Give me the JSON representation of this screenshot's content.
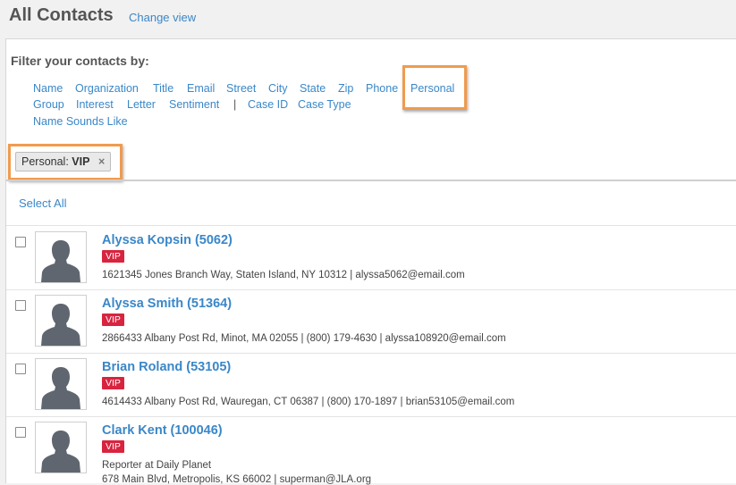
{
  "header": {
    "title": "All Contacts",
    "change_view": "Change view"
  },
  "filter": {
    "title": "Filter your contacts by:",
    "options": [
      "Name",
      "Organization",
      "Title",
      "Email",
      "Street",
      "City",
      "State",
      "Zip",
      "Phone",
      "Personal",
      "Group",
      "Interest",
      "Letter",
      "Sentiment",
      "Case ID",
      "Case Type",
      "Name Sounds Like"
    ],
    "separator": "|",
    "highlighted_option": "Personal"
  },
  "active_filter": {
    "label": "Personal:",
    "value": "VIP",
    "remove": "×"
  },
  "list": {
    "select_all": "Select All",
    "contacts": [
      {
        "name": "Alyssa Kopsin (5062)",
        "badge": "VIP",
        "details": "1621345 Jones Branch Way, Staten Island, NY 10312 | alyssa5062@email.com",
        "details2": ""
      },
      {
        "name": "Alyssa Smith (51364)",
        "badge": "VIP",
        "details": "2866433 Albany Post Rd, Minot, MA 02055 | (800) 179-4630 | alyssa108920@email.com",
        "details2": ""
      },
      {
        "name": "Brian Roland (53105)",
        "badge": "VIP",
        "details": "4614433 Albany Post Rd, Wauregan, CT 06387 | (800) 170-1897 | brian53105@email.com",
        "details2": ""
      },
      {
        "name": "Clark Kent (100046)",
        "badge": "VIP",
        "details": "Reporter at Daily Planet",
        "details2": "678 Main Blvd, Metropolis, KS 66002 | superman@JLA.org"
      }
    ]
  },
  "colors": {
    "link": "#3a87c8",
    "highlight": "#f09b4f",
    "vip": "#d8243f"
  }
}
